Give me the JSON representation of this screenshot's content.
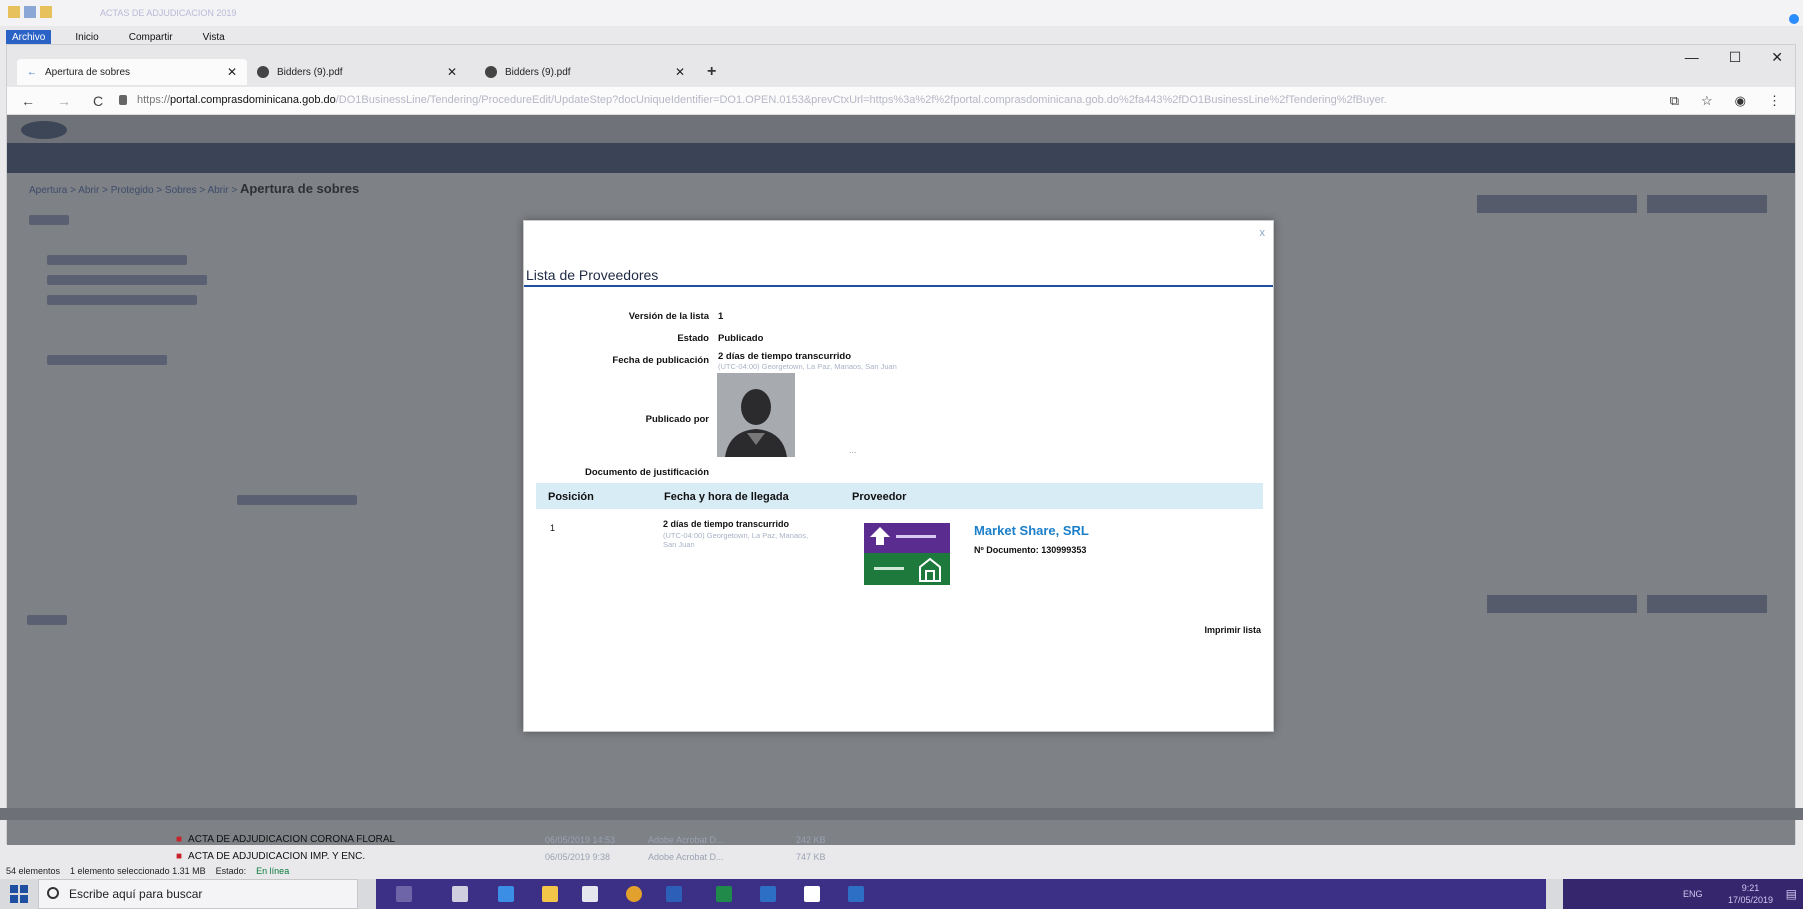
{
  "explorer": {
    "faded_title": "ACTAS DE ADJUDICACION 2019",
    "tabs": [
      "Archivo",
      "Inicio",
      "Compartir",
      "Vista"
    ]
  },
  "browser": {
    "tabs": [
      {
        "label": "Apertura de sobres"
      },
      {
        "label": "Bidders (9).pdf"
      },
      {
        "label": "Bidders (9).pdf"
      }
    ],
    "url_scheme": "https://",
    "url_host": "portal.comprasdominicana.gob.do",
    "url_rest": "/DO1BusinessLine/Tendering/ProcedureEdit/UpdateStep?docUniqueIdentifier=DO1.OPEN.0153&prevCtxUrl=https%3a%2f%2fportal.comprasdominicana.gob.do%2fa443%2fDO1BusinessLine%2fTendering%2fBuyer..."
  },
  "page": {
    "breadcrumb_trail": "Apertura > Abrir > Protegido > Sobres > Abrir >",
    "breadcrumb_title": "Apertura de sobres"
  },
  "modal": {
    "title": "Lista de Proveedores",
    "labels": {
      "version": "Versión de la lista",
      "estado": "Estado",
      "fecha": "Fecha de publicación",
      "publicado_por": "Publicado por",
      "documento": "Documento de justificación"
    },
    "values": {
      "version": "1",
      "estado": "Publicado",
      "fecha": "2 días de tiempo transcurrido",
      "fecha_detail": "(UTC-04:00) Georgetown, La Paz, Manaos, San Juan"
    },
    "table": {
      "headers": [
        "Posición",
        "Fecha y hora de llegada",
        "Proveedor"
      ],
      "rows": [
        {
          "position": "1",
          "arrival": "2 días de tiempo transcurrido",
          "arrival_detail": "(UTC-04:00) Georgetown, La Paz, Manaos, San Juan",
          "supplier": "Market Share, SRL",
          "document": "Nº Documento: 130999353"
        }
      ]
    },
    "print_label": "Imprimir lista",
    "close_label": "x"
  },
  "files": [
    {
      "name": "ACTA DE ADJUDICACION CORONA FLORAL",
      "date": "06/05/2019 14:53",
      "type": "Adobe Acrobat D...",
      "size": "242 KB"
    },
    {
      "name": "ACTA DE ADJUDICACION IMP. Y ENC.",
      "date": "06/05/2019 9:38",
      "type": "Adobe Acrobat D...",
      "size": "747 KB"
    }
  ],
  "status_bar": {
    "count": "54 elementos",
    "selection": "1 elemento seleccionado  1.31 MB",
    "state_label": "Estado:",
    "state_value": "En línea"
  },
  "taskbar": {
    "search_placeholder": "Escribe aquí para buscar",
    "lang": "ENG",
    "time": "9:21",
    "date": "17/05/2019"
  }
}
